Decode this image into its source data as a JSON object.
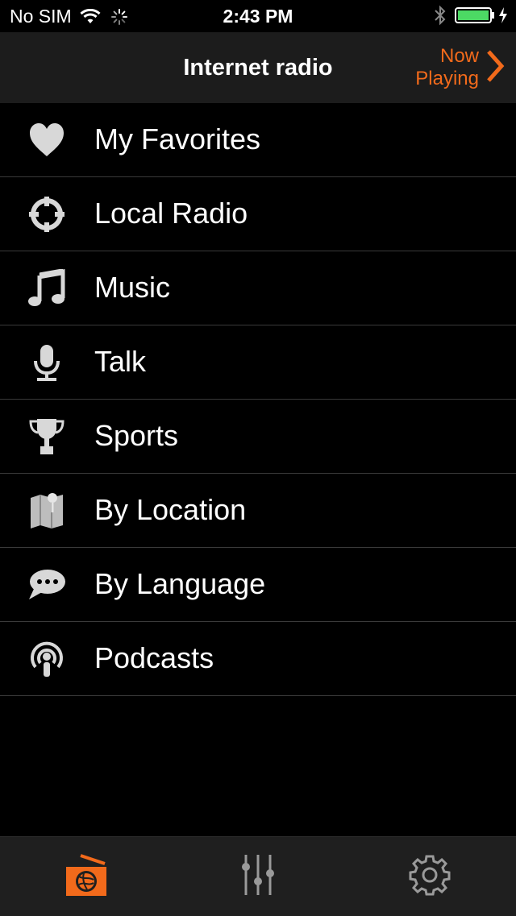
{
  "status_bar": {
    "carrier": "No SIM",
    "time": "2:43 PM",
    "icons": [
      "wifi-icon",
      "activity-spinner-icon",
      "bluetooth-icon",
      "battery-icon",
      "charging-bolt-icon"
    ]
  },
  "nav": {
    "title": "Internet radio",
    "now_playing_line1": "Now",
    "now_playing_line2": "Playing",
    "accent_color": "#f26a1b"
  },
  "menu": {
    "items": [
      {
        "label": "My Favorites",
        "icon": "heart-icon"
      },
      {
        "label": "Local Radio",
        "icon": "crosshair-icon"
      },
      {
        "label": "Music",
        "icon": "music-note-icon"
      },
      {
        "label": "Talk",
        "icon": "microphone-icon"
      },
      {
        "label": "Sports",
        "icon": "trophy-icon"
      },
      {
        "label": "By Location",
        "icon": "map-pin-icon"
      },
      {
        "label": "By Language",
        "icon": "speech-bubble-icon"
      },
      {
        "label": "Podcasts",
        "icon": "podcast-icon"
      }
    ]
  },
  "tab_bar": {
    "tabs": [
      {
        "icon": "radio-icon",
        "selected": true
      },
      {
        "icon": "equalizer-icon",
        "selected": false
      },
      {
        "icon": "gear-icon",
        "selected": false
      }
    ]
  }
}
